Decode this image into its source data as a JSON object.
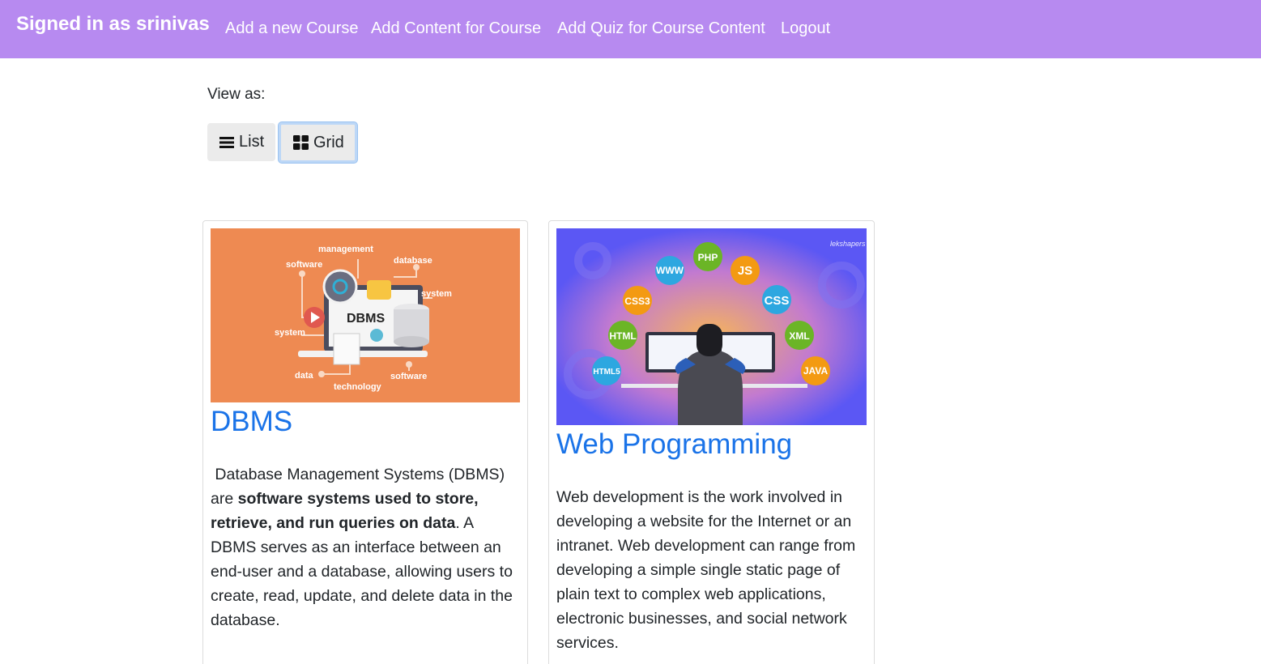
{
  "navbar": {
    "brand": "Signed in as srinivas",
    "links": [
      "Add a new Course",
      "Add Content for Course",
      "Add Quiz for Course Content",
      "Logout"
    ],
    "color": "#b78af0"
  },
  "view": {
    "label": "View as:",
    "list_label": "List",
    "grid_label": "Grid",
    "selected": "Grid"
  },
  "courses": [
    {
      "title": "DBMS",
      "image_words": [
        "management",
        "software",
        "database",
        "system",
        "system",
        "DBMS",
        "data",
        "software",
        "technology"
      ],
      "desc_pre": " Database Management Systems (DBMS) are ",
      "desc_bold": "software systems used to store, retrieve, and run queries on data",
      "desc_post": ". A DBMS serves as an interface between an end-user and a database, allowing users to create, read, update, and delete data in the database."
    },
    {
      "title": "Web Programming",
      "image_badges": [
        "WWW",
        "PHP",
        "JS",
        "CSS3",
        "CSS",
        "HTML",
        "XML",
        "HTML5",
        "JAVA"
      ],
      "image_watermark": "lekshapers",
      "desc": "Web development is the work involved in developing a website for the Internet or an intranet. Web development can range from developing a simple single static page of plain text to complex web applications, electronic businesses, and social network services."
    }
  ],
  "colors": {
    "title_link": "#1a73e8",
    "dbms_bg": "#ee8a52",
    "grid_focus": "#bcd7f7"
  }
}
